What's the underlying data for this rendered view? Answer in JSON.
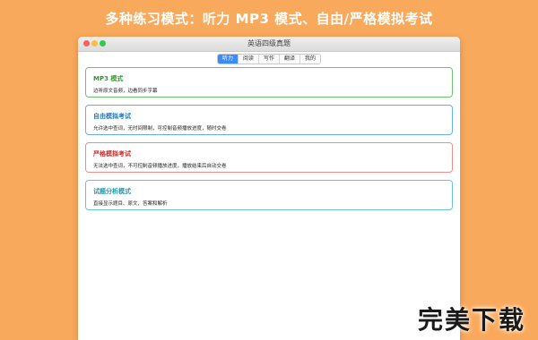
{
  "promo": {
    "title": "多种练习模式：听力 MP3 模式、自由/严格模拟考试"
  },
  "window": {
    "title": "英语四级真题"
  },
  "tabs": [
    {
      "label": "听力",
      "active": true
    },
    {
      "label": "阅读"
    },
    {
      "label": "写作"
    },
    {
      "label": "翻译"
    },
    {
      "label": "我的"
    }
  ],
  "modes": [
    {
      "title": "MP3 模式",
      "desc": "边听原文音频，边看同步字幕",
      "color": "#2e9b2e"
    },
    {
      "title": "自由模拟考试",
      "desc": "允许选中查词，无时间限制，可控制音频播放进度，随时交卷",
      "color": "#1e78c8"
    },
    {
      "title": "严格模拟考试",
      "desc": "无法选中查词，不可控制音频播放进度，播放结束后自动交卷",
      "color": "#d02b2b"
    },
    {
      "title": "试题分析模式",
      "desc": "直接显示题目、原文、答案和解析",
      "color": "#1a97b0"
    }
  ],
  "watermark": {
    "text": "完美下载"
  }
}
